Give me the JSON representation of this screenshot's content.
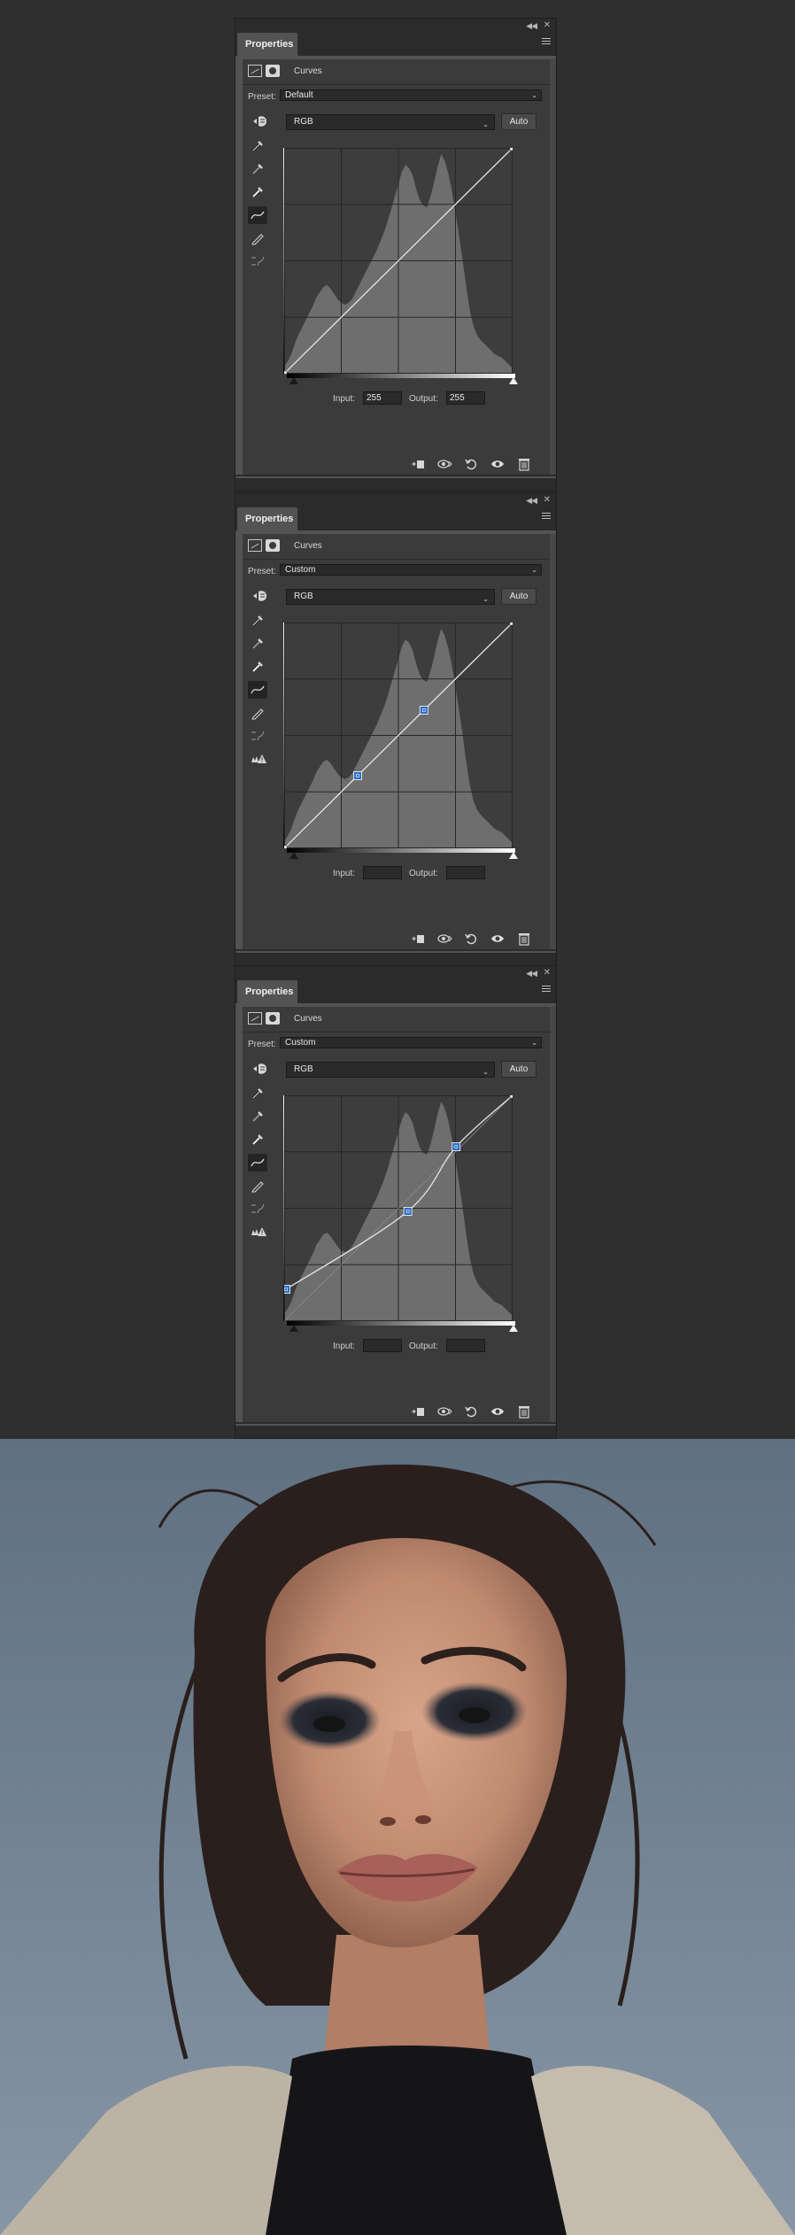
{
  "panels": [
    {
      "tab_label": "Properties",
      "adjustment_label": "Curves",
      "preset_label": "Preset:",
      "preset_value": "Default",
      "channel_value": "RGB",
      "auto_label": "Auto",
      "input_label": "Input:",
      "input_value": "255",
      "output_label": "Output:",
      "output_value": "255",
      "curve_points": [
        [
          0,
          0
        ],
        [
          255,
          255
        ]
      ],
      "show_clipping_warning": false
    },
    {
      "tab_label": "Properties",
      "adjustment_label": "Curves",
      "preset_label": "Preset:",
      "preset_value": "Custom",
      "channel_value": "RGB",
      "auto_label": "Auto",
      "input_label": "Input:",
      "input_value": "",
      "output_label": "Output:",
      "output_value": "",
      "curve_points": [
        [
          0,
          0
        ],
        [
          82,
          82
        ],
        [
          156,
          156
        ],
        [
          255,
          255
        ]
      ],
      "show_clipping_warning": true
    },
    {
      "tab_label": "Properties",
      "adjustment_label": "Curves",
      "preset_label": "Preset:",
      "preset_value": "Custom",
      "channel_value": "RGB",
      "auto_label": "Auto",
      "input_label": "Input:",
      "input_value": "",
      "output_label": "Output:",
      "output_value": "",
      "curve_points": [
        [
          2,
          36
        ],
        [
          138,
          124
        ],
        [
          192,
          197
        ],
        [
          255,
          255
        ]
      ],
      "show_clipping_warning": true
    }
  ],
  "histogram": [
    8,
    14,
    22,
    34,
    44,
    52,
    60,
    68,
    76,
    86,
    92,
    98,
    100,
    96,
    90,
    84,
    80,
    78,
    80,
    84,
    92,
    100,
    108,
    116,
    124,
    132,
    140,
    150,
    160,
    172,
    186,
    200,
    214,
    228,
    236,
    232,
    224,
    208,
    196,
    190,
    188,
    200,
    216,
    234,
    248,
    240,
    226,
    206,
    182,
    156,
    128,
    98,
    72,
    54,
    44,
    38,
    34,
    30,
    26,
    22,
    20,
    18,
    14,
    10,
    6
  ],
  "colors": {
    "panel_bg": "#535353",
    "content_bg": "#3b3b3b",
    "graph_bg": "#3d3d3d",
    "histogram": "#6e6e6e",
    "curve_line": "#e6e6e6",
    "point_blue": "#2f6fc4",
    "photo_sky": "#6b7c8c"
  }
}
